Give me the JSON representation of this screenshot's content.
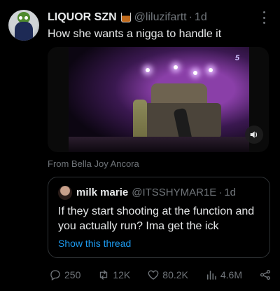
{
  "tweet": {
    "display_name": "LIQUOR SZN",
    "name_emoji": "tumbler-glass-emoji",
    "handle": "@liluzifartt",
    "separator": "·",
    "time": "1d",
    "text": "How she wants a nigga to handle it",
    "media": {
      "type": "video",
      "channel_logo": "5",
      "attribution": "From Bella Joy Ancora"
    }
  },
  "quote": {
    "display_name": "milk marie",
    "handle": "@ITSSHYMAR1E",
    "separator": "·",
    "time": "1d",
    "text": "If they start shooting at the function and you actually run? Ima get the ick",
    "show_thread": "Show this thread"
  },
  "actions": {
    "replies": "250",
    "reposts": "12K",
    "likes": "80.2K",
    "views": "4.6M"
  },
  "colors": {
    "background": "#000000",
    "primary_text": "#e7e9ea",
    "secondary_text": "#71767b",
    "link": "#1d9bf0",
    "border": "#2f3336"
  }
}
